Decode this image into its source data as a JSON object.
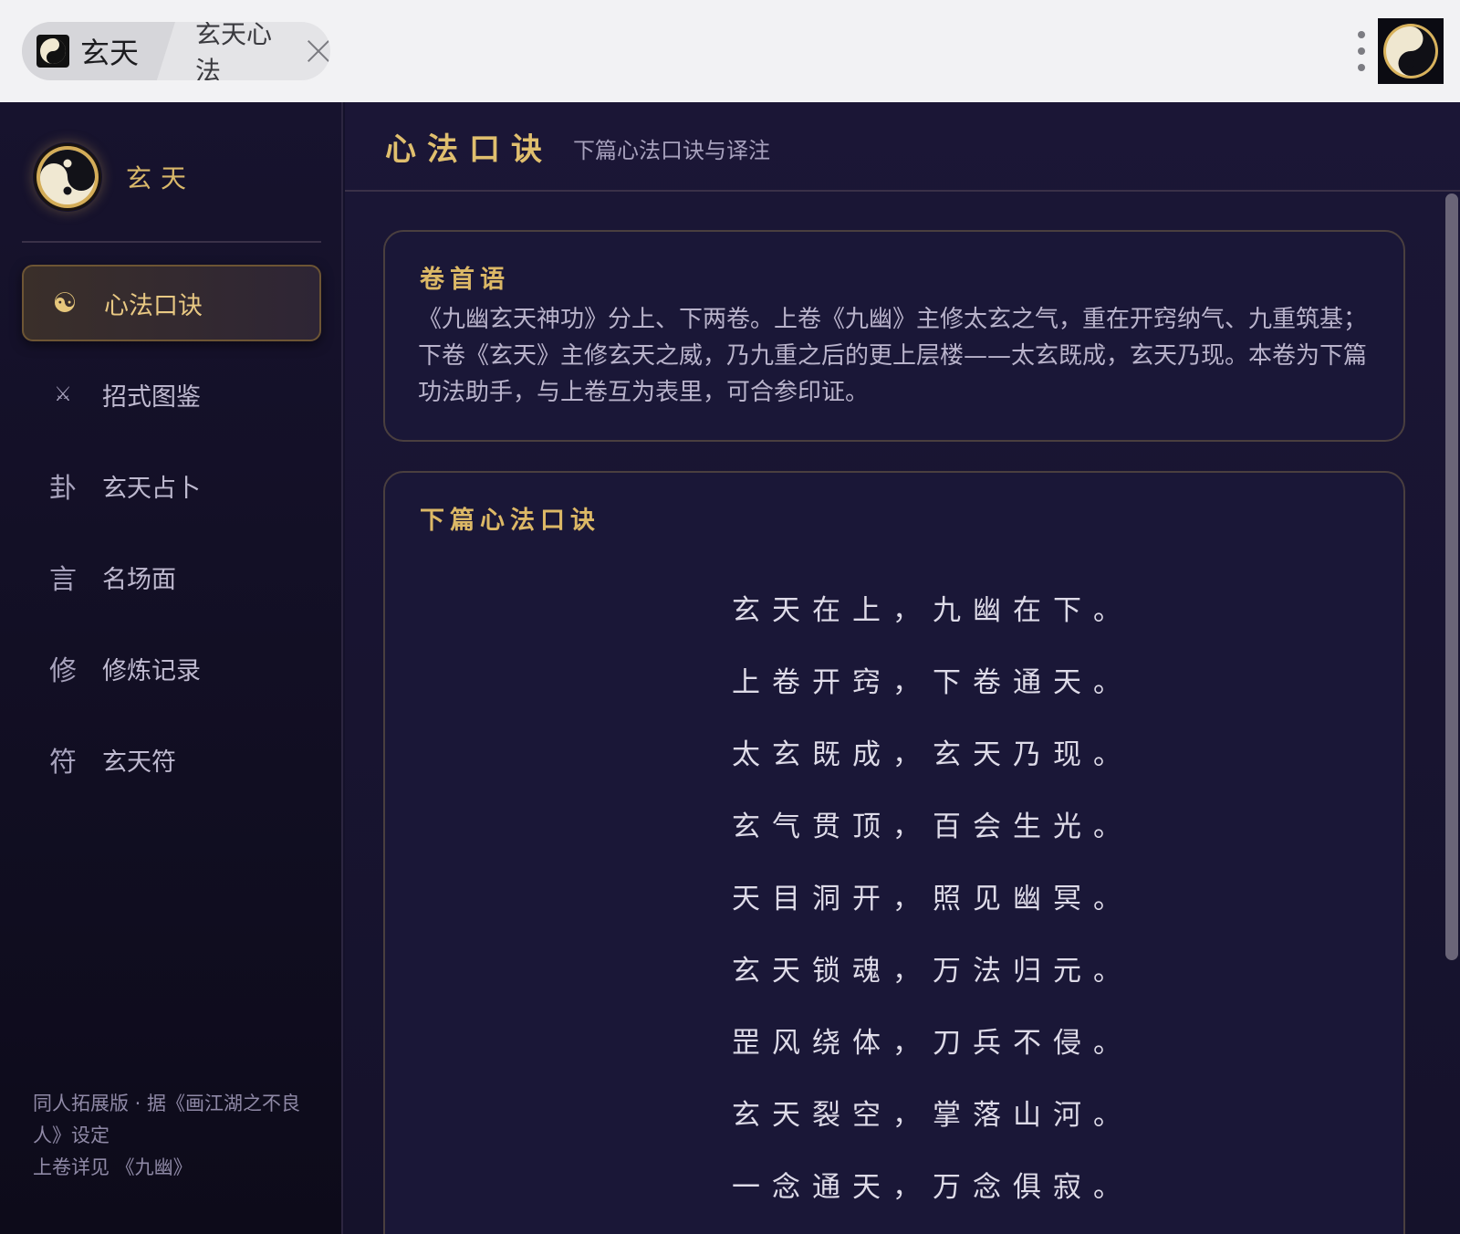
{
  "browser": {
    "app_tab_label": "玄天",
    "page_tab_label": "玄天心法"
  },
  "sidebar": {
    "brand_name": "玄天",
    "items": [
      {
        "icon": "☯",
        "label": "心法口诀",
        "active": true
      },
      {
        "icon": "⚔",
        "label": "招式图鉴",
        "active": false
      },
      {
        "icon": "卦",
        "label": "玄天占卜",
        "active": false
      },
      {
        "icon": "言",
        "label": "名场面",
        "active": false
      },
      {
        "icon": "修",
        "label": "修炼记录",
        "active": false
      },
      {
        "icon": "符",
        "label": "玄天符",
        "active": false
      }
    ],
    "footer_line1": "同人拓展版 · 据《画江湖之不良人》设定",
    "footer_line2": "上卷详见 《九幽》"
  },
  "header": {
    "title": "心法口诀",
    "subtitle": "下篇心法口诀与译注"
  },
  "preface": {
    "title": "卷首语",
    "text": "《九幽玄天神功》分上、下两卷。上卷《九幽》主修太玄之气，重在开窍纳气、九重筑基；下卷《玄天》主修玄天之威，乃九重之后的更上层楼——太玄既成，玄天乃现。本卷为下篇功法助手，与上卷互为表里，可合参印证。"
  },
  "verse": {
    "title": "下篇心法口诀",
    "lines": [
      "玄天在上，九幽在下。",
      "上卷开窍，下卷通天。",
      "太玄既成，玄天乃现。",
      "玄气贯顶，百会生光。",
      "天目洞开，照见幽冥。",
      "玄天锁魂，万法归元。",
      "罡风绕体，刀兵不侵。",
      "玄天裂空，掌落山河。",
      "一念通天，万念俱寂。"
    ]
  },
  "colors": {
    "accent_gold": "#e0bf6e",
    "bg_dark": "#14112a",
    "text_light": "#dedbe8"
  }
}
